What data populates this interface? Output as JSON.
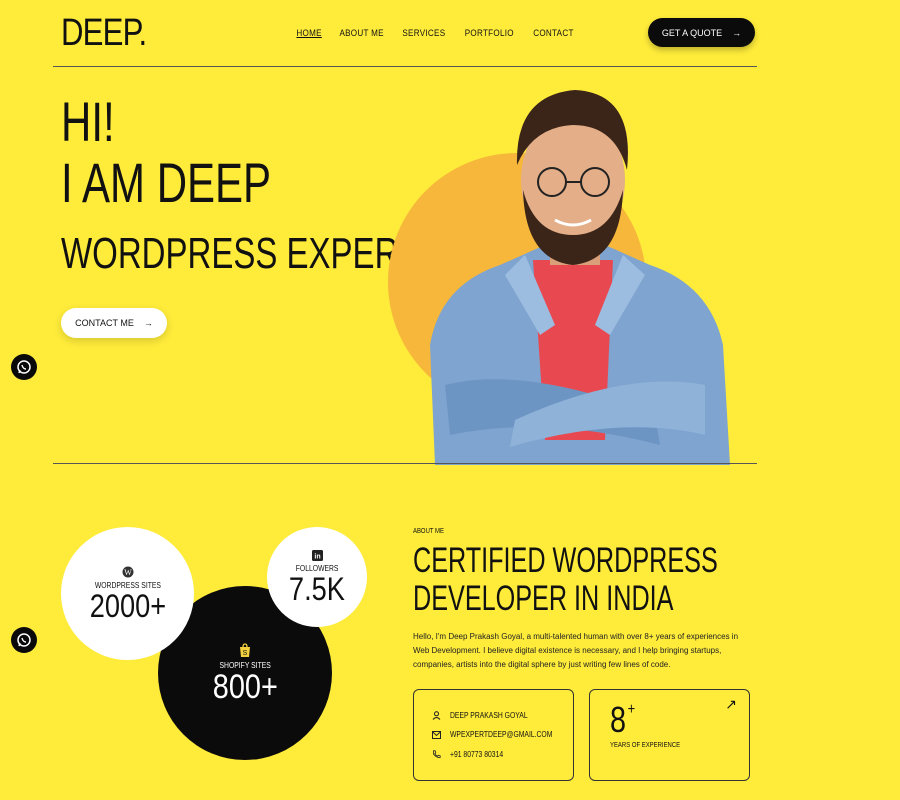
{
  "header": {
    "logo": "DEEP.",
    "nav": [
      "HOME",
      "ABOUT ME",
      "SERVICES",
      "PORTFOLIO",
      "CONTACT"
    ],
    "cta_label": "GET A QUOTE"
  },
  "hero": {
    "line1": "HI!",
    "line2": "I AM DEEP",
    "line3": "WORDPRESS EXPERT",
    "contact_label": "CONTACT ME"
  },
  "stats": {
    "wordpress": {
      "label": "WORDPRESS SITES",
      "value": "2000+"
    },
    "followers": {
      "label": "FOLLOWERS",
      "value": "7.5K"
    },
    "shopify": {
      "label": "SHOPIFY SITES",
      "value": "800+"
    }
  },
  "about": {
    "eyebrow": "ABOUT ME",
    "title_line1": "CERTIFIED WORDPRESS",
    "title_line2": "DEVELOPER IN INDIA",
    "paragraph": "Hello, I'm Deep Prakash Goyal, a multi-talented human with over 8+ years of experiences in Web Development. I believe digital existence is necessary, and I help bringing startups, companies, artists into the digital sphere by just writing few lines of code.",
    "contact": {
      "name": "DEEP PRAKASH GOYAL",
      "email": "WPEXPERTDEEP@GMAIL.COM",
      "phone": "+91 80773 80314"
    },
    "experience": {
      "value": "8",
      "plus": "+",
      "label": "YEARS OF EXPERIENCE"
    }
  },
  "colors": {
    "background": "#feeb3a",
    "accent_circle": "#f7b73a",
    "dark": "#0b0b0b"
  }
}
